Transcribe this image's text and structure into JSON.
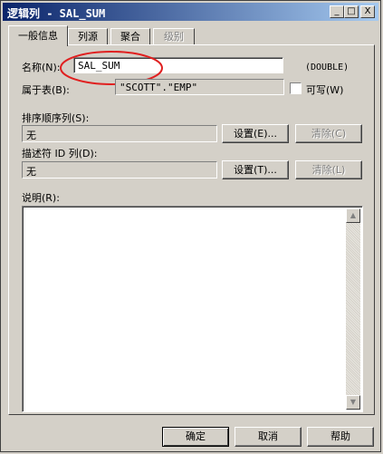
{
  "window": {
    "title": "逻辑列 - SAL_SUM",
    "controls": {
      "minimize": "_",
      "maximize": "□",
      "close": "X"
    }
  },
  "tabs": [
    {
      "label": "一般信息",
      "state": "active"
    },
    {
      "label": "列源",
      "state": "normal"
    },
    {
      "label": "聚合",
      "state": "normal"
    },
    {
      "label": "级别",
      "state": "disabled"
    }
  ],
  "form": {
    "name_label": "名称(N):",
    "name_value": "SAL_SUM",
    "type_label": "(DOUBLE)",
    "table_label": "属于表(B):",
    "table_value": "\"SCOTT\".\"EMP\"",
    "writable_label": "可写(W)",
    "writable_checked": false,
    "sort_label": "排序顺序列(S):",
    "sort_value": "无",
    "sort_set_button": "设置(E)...",
    "sort_clear_button": "清除(C)",
    "descriptor_label": "描述符 ID 列(D):",
    "descriptor_value": "无",
    "descriptor_set_button": "设置(T)...",
    "descriptor_clear_button": "清除(L)",
    "description_label": "说明(R):",
    "description_value": ""
  },
  "footer": {
    "ok_button": "确定",
    "cancel_button": "取消",
    "help_button": "帮助"
  },
  "annotation": {
    "color": "#e02020"
  }
}
